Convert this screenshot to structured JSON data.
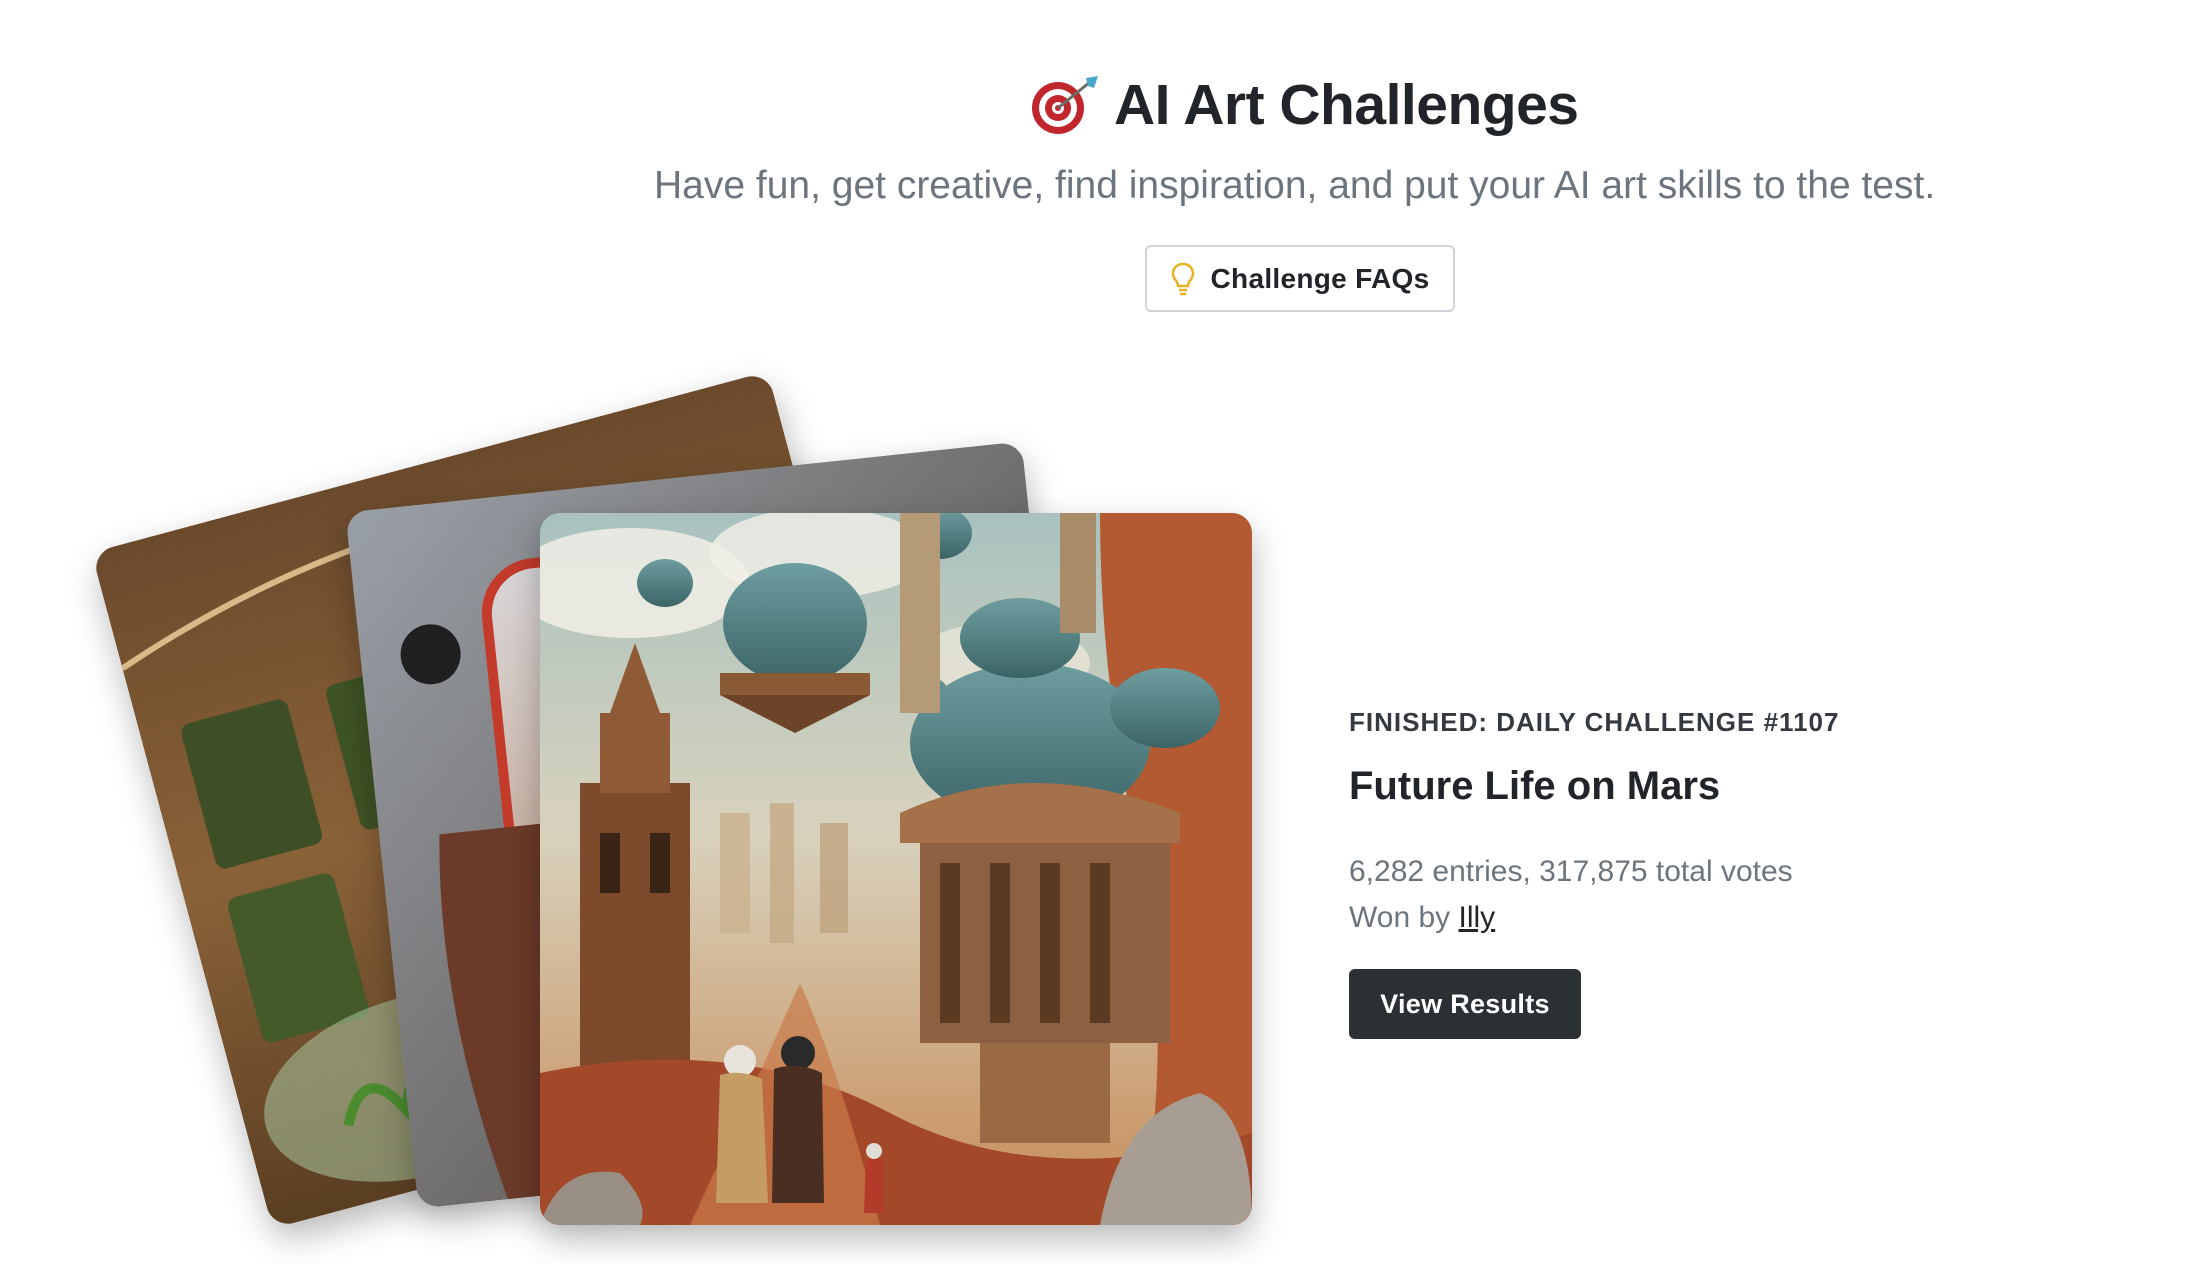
{
  "header": {
    "icon": "target-dart-icon",
    "title": "AI Art Challenges",
    "subtitle": "Have fun, get creative, find inspiration, and put your AI art skills to the test.",
    "faq_button": {
      "icon": "lightbulb-icon",
      "label": "Challenge FAQs"
    }
  },
  "challenge": {
    "status": "FINISHED: DAILY CHALLENGE #1107",
    "title": "Future Life on Mars",
    "stats": "6,282 entries, 317,875 total votes",
    "won_by_prefix": "Won by",
    "winner": "Illy",
    "results_button": "View Results"
  },
  "colors": {
    "primary_dark": "#2b3035",
    "muted_text": "#6c757d",
    "heading_text": "#212529",
    "bulb_yellow": "#e6b422"
  }
}
